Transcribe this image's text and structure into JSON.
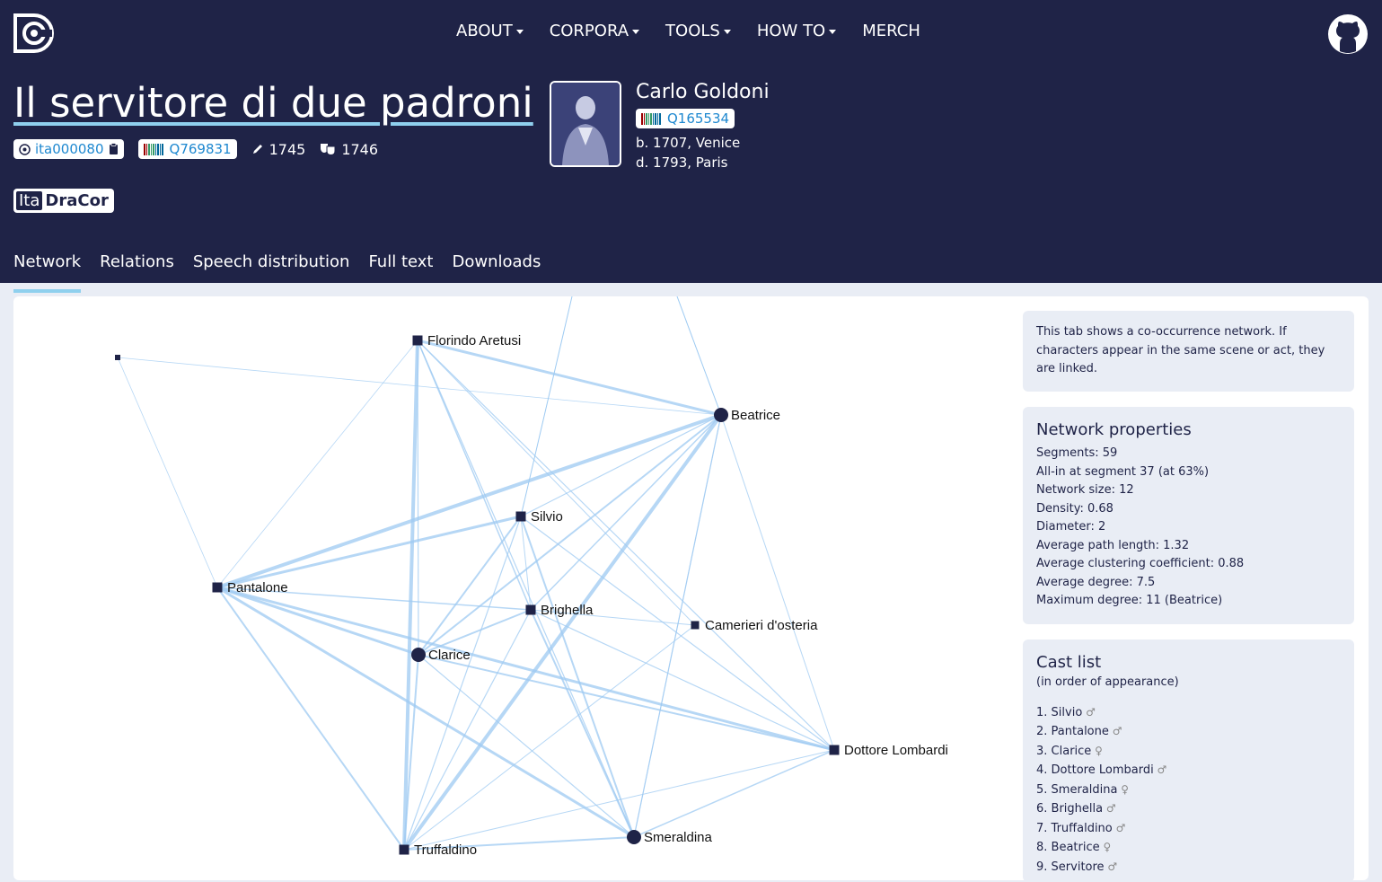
{
  "nav": {
    "items": [
      "ABOUT",
      "CORPORA",
      "TOOLS",
      "HOW TO",
      "MERCH"
    ]
  },
  "play": {
    "title": "Il servitore di due padroni",
    "id": "ita000080",
    "wikidata": "Q769831",
    "written": "1745",
    "premiered": "1746",
    "corpus_prefix": "Ita",
    "corpus_suffix": "DraCor"
  },
  "author": {
    "name": "Carlo Goldoni",
    "wikidata": "Q165534",
    "born": "b. 1707, Venice",
    "died": "d. 1793, Paris"
  },
  "tabs": [
    "Network",
    "Relations",
    "Speech distribution",
    "Full text",
    "Downloads"
  ],
  "info": {
    "text": "This tab shows a co-occurrence network. If characters appear in the same scene or act, they are linked."
  },
  "network_properties": {
    "heading": "Network properties",
    "lines": [
      "Segments: 59",
      "All-in at segment 37 (at 63%)",
      "Network size: 12",
      "Density: 0.68",
      "Diameter: 2",
      "Average path length: 1.32",
      "Average clustering coefficient: 0.88",
      "Average degree: 7.5",
      "Maximum degree: 11 (Beatrice)"
    ]
  },
  "cast": {
    "heading": "Cast list",
    "subheading": "(in order of appearance)",
    "items": [
      {
        "num": "1.",
        "name": "Silvio",
        "gender": "♂"
      },
      {
        "num": "2.",
        "name": "Pantalone",
        "gender": "♂"
      },
      {
        "num": "3.",
        "name": "Clarice",
        "gender": "♀"
      },
      {
        "num": "4.",
        "name": "Dottore Lombardi",
        "gender": "♂"
      },
      {
        "num": "5.",
        "name": "Smeraldina",
        "gender": "♀"
      },
      {
        "num": "6.",
        "name": "Brighella",
        "gender": "♂"
      },
      {
        "num": "7.",
        "name": "Truffaldino",
        "gender": "♂"
      },
      {
        "num": "8.",
        "name": "Beatrice",
        "gender": "♀"
      },
      {
        "num": "9.",
        "name": "Servitore",
        "gender": "♂"
      }
    ]
  },
  "graph": {
    "nodes": [
      {
        "id": "florindo",
        "label": "Florindo Aretusi",
        "shape": "square"
      },
      {
        "id": "beatrice",
        "label": "Beatrice",
        "shape": "circle"
      },
      {
        "id": "silvio",
        "label": "Silvio",
        "shape": "square"
      },
      {
        "id": "pantalone",
        "label": "Pantalone",
        "shape": "square"
      },
      {
        "id": "brighella",
        "label": "Brighella",
        "shape": "square"
      },
      {
        "id": "camerieri",
        "label": "Camerieri d'osteria",
        "shape": "square"
      },
      {
        "id": "clarice",
        "label": "Clarice",
        "shape": "circle"
      },
      {
        "id": "dottore",
        "label": "Dottore Lombardi",
        "shape": "square"
      },
      {
        "id": "truffaldino",
        "label": "Truffaldino",
        "shape": "square"
      },
      {
        "id": "smeraldina",
        "label": "Smeraldina",
        "shape": "circle"
      },
      {
        "id": "small",
        "label": "",
        "shape": "square"
      }
    ]
  },
  "colors": {
    "navy": "#1f2347",
    "edge": "#9dcaf2",
    "accent": "#8fd0ee",
    "link": "#1e88d0"
  }
}
